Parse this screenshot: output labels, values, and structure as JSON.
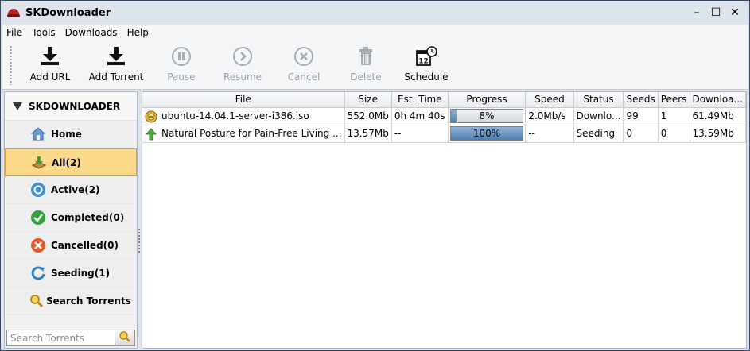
{
  "app": {
    "title": "SKDownloader"
  },
  "window_controls": {
    "minimize": "–",
    "maximize": "☐",
    "close": "✕"
  },
  "menu": {
    "items": [
      "File",
      "Tools",
      "Downloads",
      "Help"
    ]
  },
  "toolbar": {
    "add_url": "Add URL",
    "add_torrent": "Add Torrent",
    "pause": "Pause",
    "resume": "Resume",
    "cancel": "Cancel",
    "delete": "Delete",
    "schedule": "Schedule"
  },
  "sidebar": {
    "header": "SKDOWNLOADER",
    "items": [
      {
        "label": "Home",
        "icon": "home-icon"
      },
      {
        "label": "All(2)",
        "icon": "all-icon"
      },
      {
        "label": "Active(2)",
        "icon": "active-icon"
      },
      {
        "label": "Completed(0)",
        "icon": "completed-icon"
      },
      {
        "label": "Cancelled(0)",
        "icon": "cancelled-icon"
      },
      {
        "label": "Seeding(1)",
        "icon": "seeding-icon"
      },
      {
        "label": "Search Torrents",
        "icon": "search-icon"
      }
    ],
    "selected_index": 1,
    "search_placeholder": "Search Torrents"
  },
  "table": {
    "columns": [
      "File",
      "Size",
      "Est. Time",
      "Progress",
      "Speed",
      "Status",
      "Seeds",
      "Peers",
      "Downloa..."
    ],
    "rows": [
      {
        "file": "ubuntu-14.04.1-server-i386.iso",
        "size": "552.0Mb",
        "est_time": "0h 4m 40s",
        "progress_label": "8%",
        "progress": 8,
        "speed": "2.0Mb/s",
        "status": "Downlo...",
        "seeds": "99",
        "peers": "1",
        "downloaded": "61.49Mb",
        "icon": "downloading-icon"
      },
      {
        "file": "Natural Posture for Pain-Free Living ...",
        "size": "13.57Mb",
        "est_time": "--",
        "progress_label": "100%",
        "progress": 100,
        "speed": "--",
        "status": "Seeding",
        "seeds": "0",
        "peers": "0",
        "downloaded": "13.59Mb",
        "icon": "seeding-arrow-icon"
      }
    ]
  }
}
